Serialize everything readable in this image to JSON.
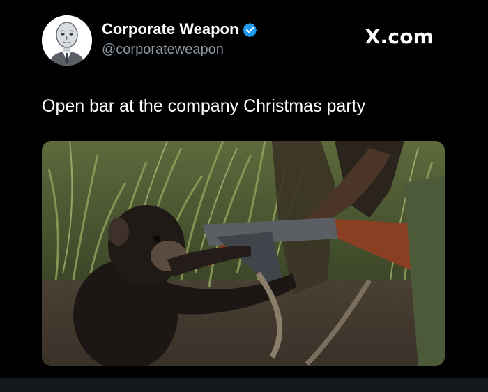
{
  "site": {
    "brand": "X.com"
  },
  "author": {
    "display_name": "Corporate Weapon",
    "handle": "@corporateweapon",
    "verified": true,
    "avatar_icon": "cartoon-man-avatar-icon",
    "verified_icon": "verified-badge-icon"
  },
  "tweet": {
    "text": "Open bar at the company Christmas party"
  },
  "media": {
    "description_icon": "photo-media"
  },
  "colors": {
    "background": "#000000",
    "text_primary": "#ffffff",
    "text_secondary": "#8b98a5",
    "verified_blue": "#1d9bf0"
  }
}
